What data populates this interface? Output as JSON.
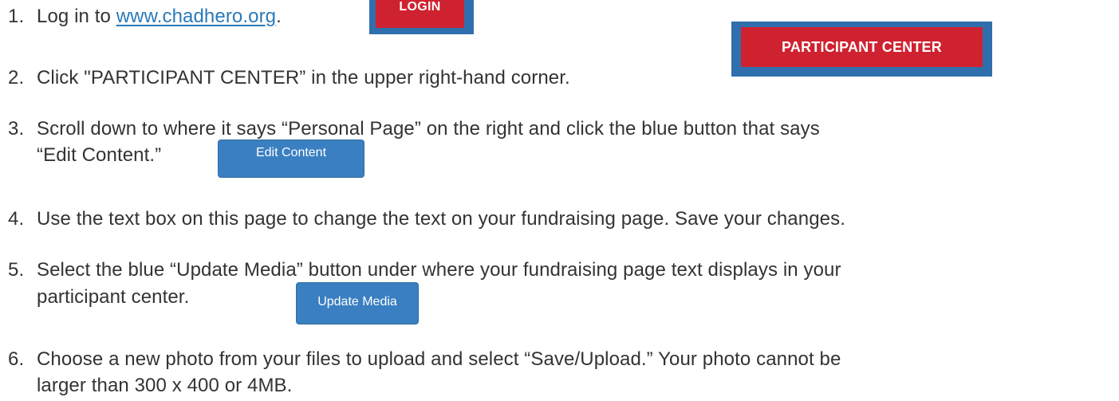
{
  "steps": [
    {
      "number": "1.",
      "prefix": "Log in to ",
      "link_text": "www.chadhero.org",
      "suffix": ".",
      "button_label": "LOGIN"
    },
    {
      "number": "2.",
      "text": "Click \"PARTICIPANT CENTER” in the upper right-hand corner.",
      "button_label": "PARTICIPANT CENTER"
    },
    {
      "number": "3.",
      "line1": "Scroll down to where it says “Personal Page” on the right and click the blue button that says",
      "line2": "“Edit Content.”",
      "button_label": "Edit Content"
    },
    {
      "number": "4.",
      "text": "Use the text box on this page to change the text on your fundraising page. Save your changes."
    },
    {
      "number": "5.",
      "line1": "Select the blue “Update Media” button under where your fundraising page text displays in your",
      "line2": "participant center.",
      "button_label": "Update Media"
    },
    {
      "number": "6.",
      "line1": "Choose a new photo from your files to upload and select “Save/Upload.” Your photo cannot be",
      "line2": "larger than 300 x 400 or 4MB."
    }
  ],
  "colors": {
    "text": "#333333",
    "link": "#2a7ab8",
    "red_button": "#cf2230",
    "frame_blue": "#2f6fad",
    "blue_button": "#3a7fc1"
  }
}
